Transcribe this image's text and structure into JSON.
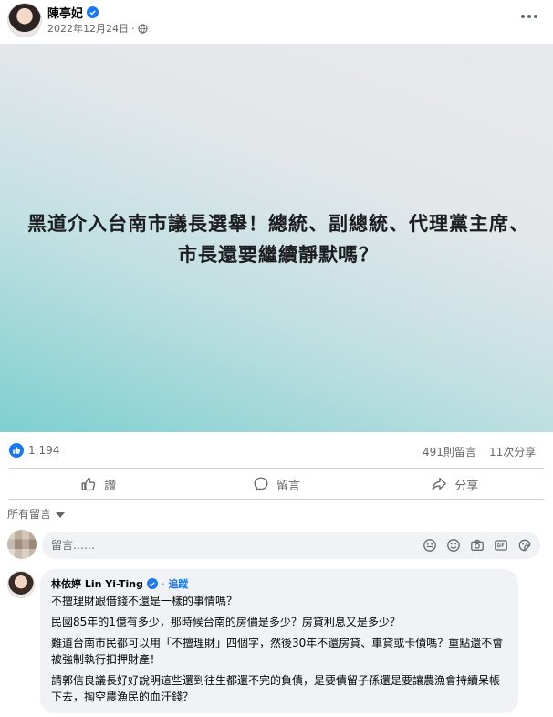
{
  "post": {
    "author_name": "陳亭妃",
    "date": "2022年12月24日",
    "date_separator": "·",
    "media_text": "黑道介入台南市議長選舉！總統、副總統、代理黨主席、市長還要繼續靜默嗎？"
  },
  "stats": {
    "reactions": "1,194",
    "comments": "491則留言",
    "shares": "11次分享"
  },
  "actions": {
    "like": "讚",
    "comment": "留言",
    "share": "分享"
  },
  "comments_section": {
    "sort_label": "所有留言",
    "composer_placeholder": "留言……"
  },
  "comment": {
    "name": "林依婷 Lin Yi-Ting",
    "separator": "·",
    "follow": "追蹤",
    "paragraphs": [
      "不擅理財跟借錢不還是一樣的事情嗎？",
      "民國85年的1億有多少，那時候台南的房價是多少？房貸利息又是多少？",
      "難道台南市民都可以用「不擅理財」四個字，然後30年不還房貸、車貸或卡債嗎？重點還不會被強制執行扣押財產！",
      "請郭信良議長好好說明這些還到往生都還不完的負債，是要債留子孫還是要讓農漁會持續呆帳下去，掏空農漁民的血汗錢？"
    ]
  },
  "icons": {
    "verified": "verified-badge-icon",
    "globe": "globe-icon",
    "more": "more-options-icon",
    "like_reaction": "like-reaction-icon",
    "like": "thumbs-up-icon",
    "comment": "comment-bubble-icon",
    "share": "share-arrow-icon",
    "sort": "caret-down-icon",
    "composer": [
      "emoji-icon",
      "smiley-icon",
      "camera-icon",
      "gif-icon",
      "sticker-icon"
    ]
  },
  "colors": {
    "accent": "#1877f2",
    "secondary_text": "#65676b",
    "bubble": "#f0f2f5"
  }
}
